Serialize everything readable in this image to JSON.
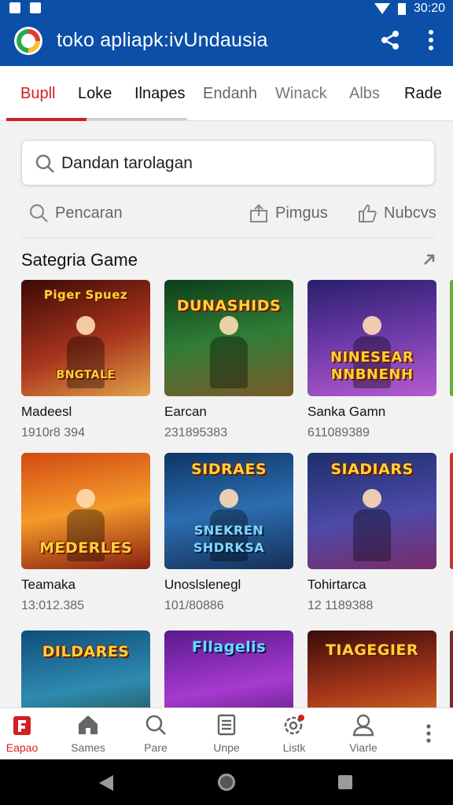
{
  "status_bar": {
    "time": "30:20"
  },
  "app_bar": {
    "title": "toko apliapk:ivUndausia"
  },
  "tabs": [
    "Bupll",
    "Loke",
    "Ilnapes",
    "Endanh",
    "Winack",
    "Albs",
    "Rade"
  ],
  "search": {
    "value": "Dandan tarolagan"
  },
  "actions": [
    "Pencaran",
    "Pimgus",
    "Nubcvs"
  ],
  "section": {
    "title": "Sategria Game"
  },
  "games": [
    {
      "art": "Piger Spuez",
      "art2": "BNGTALE",
      "name": "Madeesl",
      "count": "1910r8 394"
    },
    {
      "art": "DUNASHIDS",
      "art2": "",
      "name": "Earcan",
      "count": "231895383"
    },
    {
      "art": "NINESEAR NNBNENH",
      "art2": "",
      "name": "Sanka Gamn",
      "count": "611089389"
    },
    {
      "art": "MEDERLES",
      "art2": "",
      "name": "Teamaka",
      "count": "13:012.385"
    },
    {
      "art": "SIDRAES",
      "art2": "SNEKREN SHDRKSA",
      "name": "Unoslslenegl",
      "count": "101/80886"
    },
    {
      "art": "SIADIARS",
      "art2": "",
      "name": "Tohirtarca",
      "count": "12 1189388"
    },
    {
      "art": "DILDARES",
      "art2": "",
      "name": "",
      "count": ""
    },
    {
      "art": "Fllagelis",
      "art2": "",
      "name": "",
      "count": ""
    },
    {
      "art": "TIAGEGIER",
      "art2": "",
      "name": "",
      "count": ""
    }
  ],
  "bottom_nav": [
    "Eapao",
    "Sames",
    "Pare",
    "Unpe",
    "Listk",
    "Viarle"
  ],
  "colors": {
    "primary": "#0b4fa8",
    "accent": "#d32020"
  }
}
